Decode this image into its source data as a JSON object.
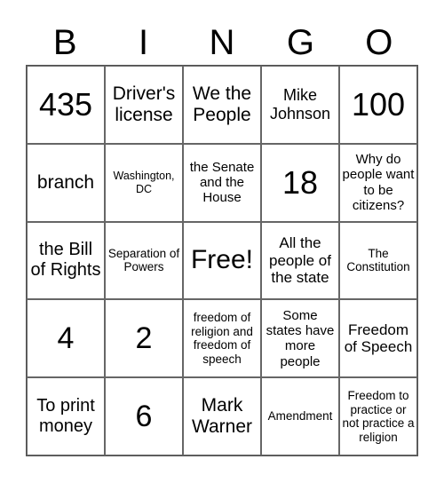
{
  "header": [
    "B",
    "I",
    "N",
    "G",
    "O"
  ],
  "cells": [
    "435",
    "Driver's license",
    "We the People",
    "Mike Johnson",
    "100",
    "branch",
    "Washington, DC",
    "the Senate and the House",
    "18",
    "Why do people want to be citizens?",
    "the Bill of Rights",
    "Separation of Powers",
    "Free!",
    "All the people of the state",
    "The Constitution",
    "4",
    "2",
    "freedom of religion and freedom of speech",
    "Some states have more people",
    "Freedom of Speech",
    "To print money",
    "6",
    "Mark Warner",
    "Amendment",
    "Freedom to practice or not practice a religion"
  ]
}
